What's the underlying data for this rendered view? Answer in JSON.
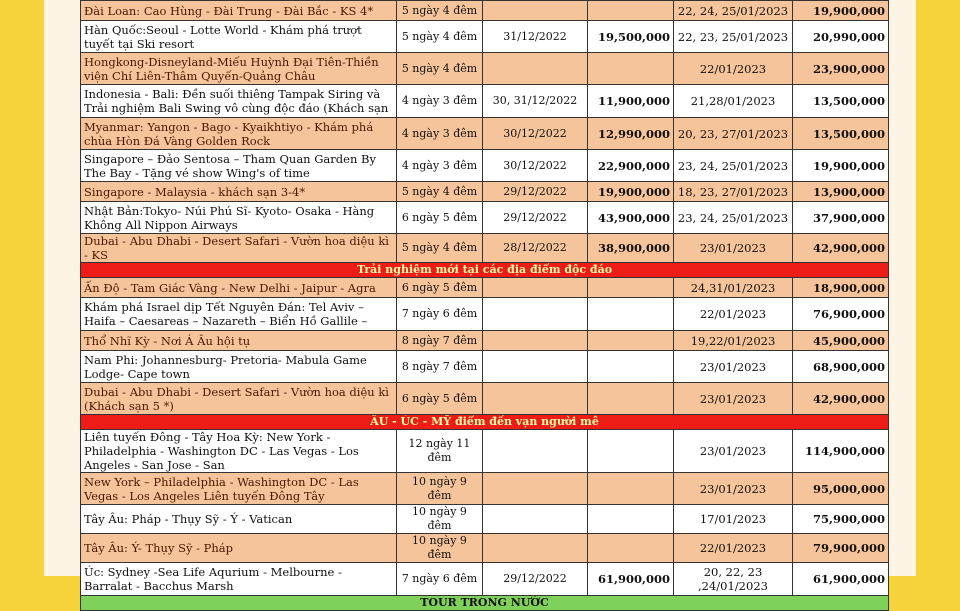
{
  "sections": [
    {
      "rows": [
        {
          "name": "Đài Loan: Cao Hùng - Đài Trung - Đài Bắc - KS 4*",
          "duration": "5 ngày 4 đêm",
          "promo_date": "",
          "promo_price": "",
          "depart": "22, 24, 25/01/2023",
          "price": "19,900,000",
          "style": "orange",
          "h": "h1"
        },
        {
          "name": "Hàn Quốc:Seoul - Lotte World - Khám phá trượt tuyết tại Ski resort",
          "duration": "5 ngày 4 đêm",
          "promo_date": "31/12/2022",
          "promo_price": "19,500,000",
          "depart": "22, 23, 25/01/2023",
          "price": "20,990,000",
          "style": "white",
          "h": "h2"
        },
        {
          "name": "Hongkong-Disneyland-Miếu Huỳnh Đại Tiên-Thiền viện Chí Liên-Thâm Quyến-Quảng Châu",
          "duration": "5 ngày 4 đêm",
          "promo_date": "",
          "promo_price": "",
          "depart": "22/01/2023",
          "price": "23,900,000",
          "style": "orange",
          "h": "h2"
        },
        {
          "name": "Indonesia - Bali: Đền suối thiêng Tampak Siring và Trải nghiệm Bali Swing vô cùng độc đáo (Khách sạn",
          "duration": "4 ngày 3 đêm",
          "promo_date": "30, 31/12/2022",
          "promo_price": "11,900,000",
          "depart": "21,28/01/2023",
          "price": "13,500,000",
          "style": "white",
          "h": "h3"
        },
        {
          "name": "Myanmar: Yangon - Bago - Kyaikhtiyo - Khám phá chùa Hòn Đá Vàng Golden Rock",
          "duration": "4 ngày 3 đêm",
          "promo_date": "30/12/2022",
          "promo_price": "12,990,000",
          "depart": "20, 23, 27/01/2023",
          "price": "13,500,000",
          "style": "orange",
          "h": "h2"
        },
        {
          "name": "Singapore – Đảo Sentosa – Tham Quan Garden By The Bay - Tặng vé show Wing's of time",
          "duration": "4 ngày 3 đêm",
          "promo_date": "30/12/2022",
          "promo_price": "22,900,000",
          "depart": "23, 24, 25/01/2023",
          "price": "19,900,000",
          "style": "white",
          "h": "h2"
        },
        {
          "name": "Singapore - Malaysia - khách sạn 3-4*",
          "duration": "5 ngày 4 đêm",
          "promo_date": "29/12/2022",
          "promo_price": "19,900,000",
          "depart": "18, 23, 27/01/2023",
          "price": "13,900,000",
          "style": "orange",
          "h": "h1"
        },
        {
          "name": "Nhật Bản:Tokyo- Núi Phú Sĩ- Kyoto- Osaka - Hàng Không All Nippon Airways",
          "duration": "6 ngày 5 đêm",
          "promo_date": "29/12/2022",
          "promo_price": "43,900,000",
          "depart": "23, 24, 25/01/2023",
          "price": "37,900,000",
          "style": "white",
          "h": "h2"
        },
        {
          "name": "Dubai - Abu Dhabi - Desert Safari - Vườn hoa diệu kì - KS",
          "duration": "5 ngày 4 đêm",
          "promo_date": "28/12/2022",
          "promo_price": "38,900,000",
          "depart": "23/01/2023",
          "price": "42,900,000",
          "style": "orange",
          "h": "h1"
        }
      ]
    },
    {
      "header": "Trải nghiệm mới tại các địa điểm độc đáo",
      "rows": [
        {
          "name": "Ấn Độ - Tam Giác Vàng - New Delhi - Jaipur - Agra",
          "duration": "6 ngày 5 đêm",
          "promo_date": "",
          "promo_price": "",
          "depart": "24,31/01/2023",
          "price": "18,900,000",
          "style": "orange",
          "h": "h1"
        },
        {
          "name": "Khám phá Israel dịp Tết Nguyên Đán: Tel Aviv – Haifa – Caesareas – Nazareth – Biển Hồ Gallile –",
          "duration": "7 ngày 6 đêm",
          "promo_date": "",
          "promo_price": "",
          "depart": "22/01/2023",
          "price": "76,900,000",
          "style": "white",
          "h": "h3"
        },
        {
          "name": "Thổ Nhĩ Kỳ - Nơi Á Âu hội tụ",
          "duration": "8 ngày 7 đêm",
          "promo_date": "",
          "promo_price": "",
          "depart": "19,22/01/2023",
          "price": "45,900,000",
          "style": "orange",
          "h": "h1"
        },
        {
          "name": "Nam Phi: Johannesburg- Pretoria- Mabula Game Lodge- Cape town",
          "duration": "8 ngày 7 đêm",
          "promo_date": "",
          "promo_price": "",
          "depart": "23/01/2023",
          "price": "68,900,000",
          "style": "white",
          "h": "h2"
        },
        {
          "name": "Dubai - Abu Dhabi - Desert Safari - Vườn hoa diệu kì (Khách sạn 5 *)",
          "duration": "6 ngày 5 đêm",
          "promo_date": "",
          "promo_price": "",
          "depart": "23/01/2023",
          "price": "42,900,000",
          "style": "orange",
          "h": "h2"
        }
      ]
    },
    {
      "header": "ÂU - ÚC - MỸ điểm đến vạn người mê",
      "rows": [
        {
          "name": "Liên tuyến Đông - Tây Hoa Kỳ: New York - Philadelphia - Washington DC - Las Vegas - Los Angeles - San Jose - San",
          "duration": "12 ngày 11 đêm",
          "promo_date": "",
          "promo_price": "",
          "depart": "23/01/2023",
          "price": "114,900,000",
          "style": "white",
          "h": "h3"
        },
        {
          "name": "New York – Philadelphia - Washington DC - Las Vegas - Los Angeles Liên tuyến Đông Tây",
          "duration": "10 ngày 9 đêm",
          "promo_date": "",
          "promo_price": "",
          "depart": "23/01/2023",
          "price": "95,000,000",
          "style": "orange",
          "h": "h2"
        },
        {
          "name": "Tây Âu: Pháp - Thụy Sỹ - Ý - Vatican",
          "duration": "10 ngày 9 đêm",
          "promo_date": "",
          "promo_price": "",
          "depart": "17/01/2023",
          "price": "75,900,000",
          "style": "white",
          "h": "h1"
        },
        {
          "name": "Tây Âu: Ý- Thụy Sỹ - Pháp",
          "duration": "10 ngày 9 đêm",
          "promo_date": "",
          "promo_price": "",
          "depart": "22/01/2023",
          "price": "79,900,000",
          "style": "orange",
          "h": "h1"
        },
        {
          "name": "Úc: Sydney -Sea Life Aqurium - Melbourne - Barralat - Bacchus Marsh",
          "duration": "7 ngày 6 đêm",
          "promo_date": "29/12/2022",
          "promo_price": "61,900,000",
          "depart": "20, 22, 23 ,24/01/2023",
          "price": "61,900,000",
          "style": "white",
          "h": "h3"
        }
      ]
    },
    {
      "header": "TOUR TRONG NƯỚC",
      "header_style": "green",
      "rows": []
    }
  ],
  "colors": {
    "background": "#f6d23b",
    "row_orange": "#f6c49a",
    "header_red": "#ee1c16",
    "header_green": "#7fd15b"
  }
}
